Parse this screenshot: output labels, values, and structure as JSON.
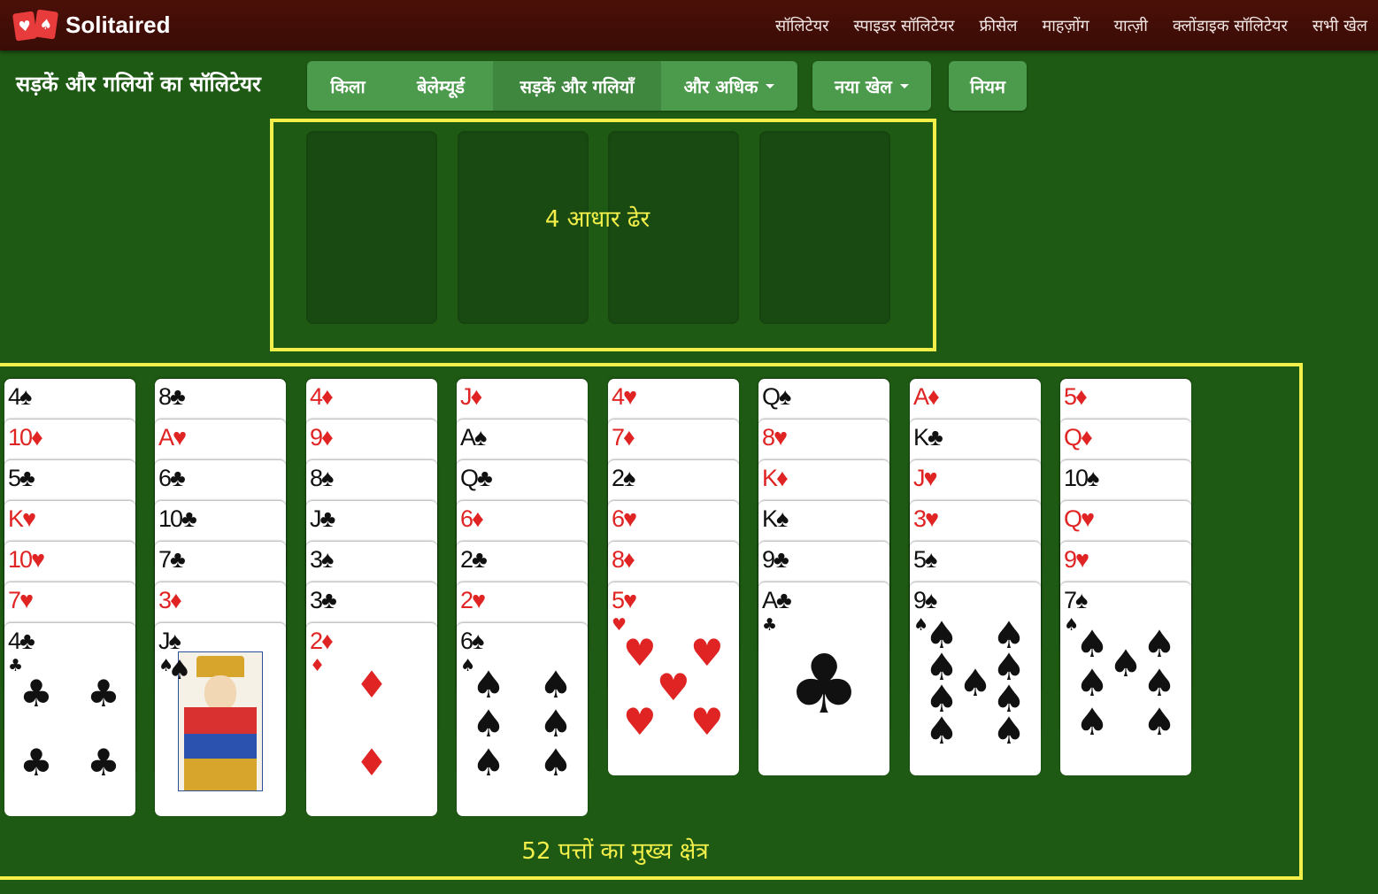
{
  "brand": {
    "name": "Solitaired"
  },
  "nav": [
    "सॉलिटेयर",
    "स्पाइडर सॉलिटेयर",
    "फ्रीसेल",
    "माहज़ोंग",
    "यात्ज़ी",
    "क्लोंडाइक सॉलिटेयर",
    "सभी खेल"
  ],
  "page_title": "सड़कें और गलियों का सॉलिटेयर",
  "variants": [
    {
      "label": "किला",
      "active": false
    },
    {
      "label": "बेलेम्यूर्ड",
      "active": false
    },
    {
      "label": "सड़कें और गलियाँ",
      "active": true
    },
    {
      "label": "और अधिक",
      "dropdown": true,
      "active": false
    }
  ],
  "new_game": "नया खेल",
  "rules": "नियम",
  "foundation_label": "4 आधार ढेर",
  "tableau_label": "52 पत्तों का मुख्य क्षेत्र",
  "tableau": [
    [
      "4♠",
      "10♦",
      "5♣",
      "K♥",
      "10♥",
      "7♥",
      "4♣"
    ],
    [
      "8♣",
      "A♥",
      "6♣",
      "10♣",
      "7♣",
      "3♦",
      "J♠"
    ],
    [
      "4♦",
      "9♦",
      "8♠",
      "J♣",
      "3♠",
      "3♣",
      "2♦"
    ],
    [
      "J♦",
      "A♠",
      "Q♣",
      "6♦",
      "2♣",
      "2♥",
      "6♠"
    ],
    [
      "4♥",
      "7♦",
      "2♠",
      "6♥",
      "8♦",
      "5♥"
    ],
    [
      "Q♠",
      "8♥",
      "K♦",
      "K♠",
      "9♣",
      "A♣"
    ],
    [
      "A♦",
      "K♣",
      "J♥",
      "3♥",
      "5♠",
      "9♠"
    ],
    [
      "5♦",
      "Q♦",
      "10♠",
      "Q♥",
      "9♥",
      "7♠"
    ]
  ],
  "colors": {
    "felt": "#1e5a14",
    "highlight": "#f2ef4a",
    "button": "#4c9a4c",
    "topbar": "#4a1008",
    "red_suit": "#e02424"
  }
}
